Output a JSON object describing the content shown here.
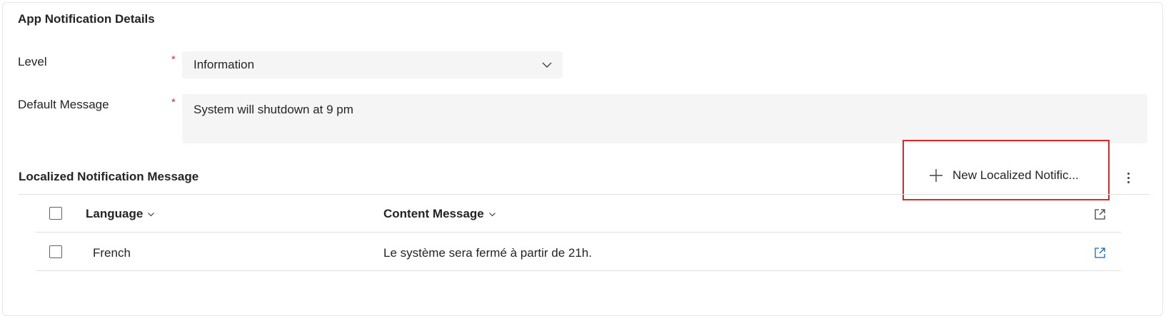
{
  "section": {
    "title": "App Notification Details"
  },
  "fields": {
    "level": {
      "label": "Level",
      "required_mark": "*",
      "value": "Information"
    },
    "default_message": {
      "label": "Default Message",
      "required_mark": "*",
      "value": "System will shutdown at 9 pm"
    }
  },
  "subgrid": {
    "title": "Localized Notification Message",
    "new_button_label": "New Localized Notific...",
    "columns": [
      "Language",
      "Content Message"
    ],
    "rows": [
      {
        "language": "French",
        "content": "Le système sera fermé à partir de 21h."
      }
    ]
  },
  "colors": {
    "required": "#c4314b",
    "highlight_border": "#d62b2b",
    "link_icon": "#0f6cbd",
    "field_bg": "#f5f5f5"
  },
  "icons": [
    "chevron-down-icon",
    "plus-icon",
    "more-vertical-icon",
    "open-in-new-icon",
    "checkbox-icon"
  ]
}
